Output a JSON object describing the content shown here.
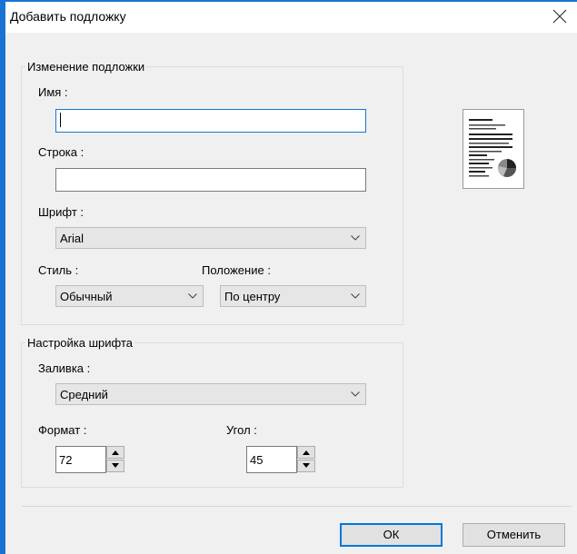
{
  "dialog": {
    "title": "Добавить подложку"
  },
  "group_edit": {
    "legend": "Изменение подложки",
    "name_label": "Имя :",
    "name_value": "",
    "line_label": "Строка :",
    "line_value": "",
    "font_label": "Шрифт :",
    "font_value": "Arial",
    "style_label": "Стиль :",
    "style_value": "Обычный",
    "position_label": "Положение :",
    "position_value": "По центру"
  },
  "group_font": {
    "legend": "Настройка шрифта",
    "fill_label": "Заливка :",
    "fill_value": "Средний",
    "format_label": "Формат :",
    "format_value": "72",
    "angle_label": "Угол :",
    "angle_value": "45"
  },
  "buttons": {
    "ok": "ОК",
    "cancel": "Отменить"
  },
  "icons": {
    "close": "close-icon",
    "chevron": "chevron-down-icon",
    "spin_up": "arrow-up-icon",
    "spin_down": "arrow-down-icon"
  },
  "colors": {
    "accent": "#1a73d2",
    "focus": "#1976d2",
    "window_bg": "#f0f0f0"
  }
}
